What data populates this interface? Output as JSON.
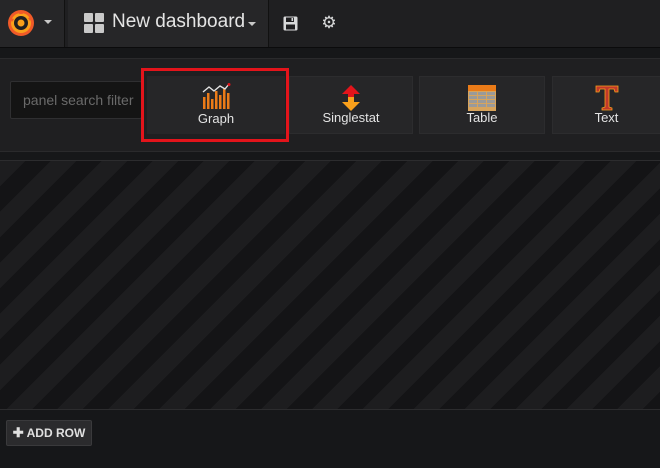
{
  "navbar": {
    "logo_icon": "grafana-logo-icon",
    "dashboard_icon": "dashboard-grid-icon",
    "dashboard_title": "New dashboard",
    "save_icon": "save-icon",
    "settings_icon": "gear-icon"
  },
  "chooser": {
    "search_placeholder": "panel search filter",
    "panels": [
      {
        "label": "Graph",
        "icon": "graph-icon",
        "highlighted": true
      },
      {
        "label": "Singlestat",
        "icon": "singlestat-icon"
      },
      {
        "label": "Table",
        "icon": "table-icon"
      },
      {
        "label": "Text",
        "icon": "text-icon"
      }
    ]
  },
  "add_row": {
    "label": "ADD ROW",
    "icon": "plus-icon"
  },
  "colors": {
    "background": "#161719",
    "highlight": "#e3141b",
    "accent_orange": "#eb7b18"
  }
}
